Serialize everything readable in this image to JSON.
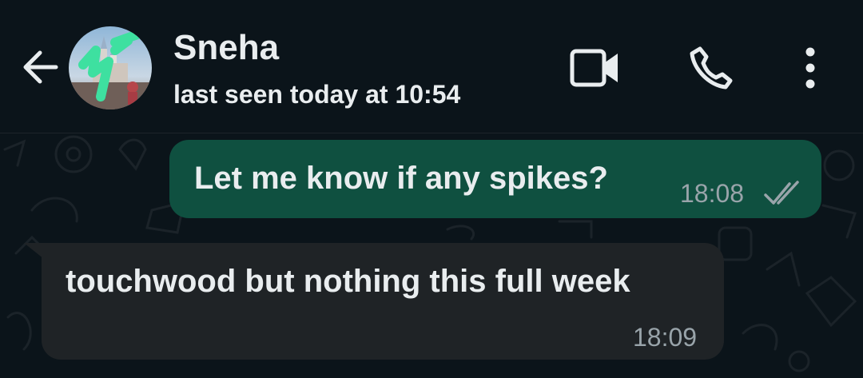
{
  "header": {
    "contact_name": "Sneha",
    "status": "last seen today at 10:54",
    "icons": {
      "back": "arrow-back-icon",
      "avatar": "profile-photo",
      "video": "video-call-icon",
      "call": "voice-call-icon",
      "menu": "more-vertical-icon"
    }
  },
  "messages": [
    {
      "direction": "outgoing",
      "text": "Let me know if any spikes?",
      "time": "18:08",
      "status_icon": "double-check-icon"
    },
    {
      "direction": "incoming",
      "text": "touchwood but nothing this full week",
      "time": "18:09"
    }
  ],
  "colors": {
    "background": "#0b141a",
    "outgoing_bubble": "#0f5040",
    "incoming_bubble": "#1f2326",
    "text": "#e9edef",
    "timestamp": "#99a4aa",
    "avatar_mark": "#3ee0a0"
  }
}
